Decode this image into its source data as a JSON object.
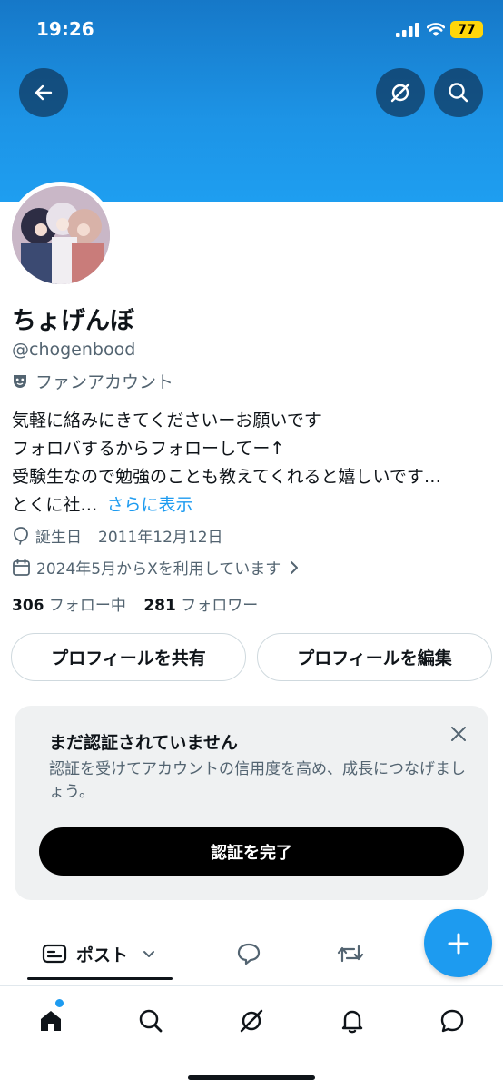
{
  "status_bar": {
    "time": "19:26",
    "battery": "77"
  },
  "profile": {
    "display_name": "ちょげんぼ",
    "handle": "@chogenbood",
    "category": "ファンアカウント",
    "bio_lines": [
      "気軽に絡みにきてくださいーお願いです",
      "フォロバするからフォローしてー↑",
      "受験生なので勉強のことも教えてくれると嬉しいです…",
      "とくに社…"
    ],
    "bio_more": "さらに表示",
    "birthday_label": "誕生日",
    "birthday_value": "2011年12月12日",
    "joined": "2024年5月からXを利用しています",
    "following_count": "306",
    "following_label": "フォロー中",
    "followers_count": "281",
    "followers_label": "フォロワー"
  },
  "buttons": {
    "share_profile": "プロフィールを共有",
    "edit_profile": "プロフィールを編集"
  },
  "verify_card": {
    "title": "まだ認証されていません",
    "text": "認証を受けてアカウントの信用度を高め、成長につなげましょう。",
    "button": "認証を完了"
  },
  "tabs": {
    "posts": "ポスト"
  },
  "colors": {
    "accent": "#1d9bf0",
    "banner": "#1e9ef0",
    "text": "#0f1419",
    "muted": "#536471"
  },
  "icons": [
    "back-arrow-icon",
    "grok-icon",
    "search-icon",
    "theater-mask-icon",
    "balloon-icon",
    "calendar-icon",
    "close-icon",
    "post-card-icon",
    "chevron-down-icon",
    "reply-icon",
    "repost-icon",
    "plus-icon",
    "home-icon",
    "bell-icon",
    "message-icon"
  ]
}
